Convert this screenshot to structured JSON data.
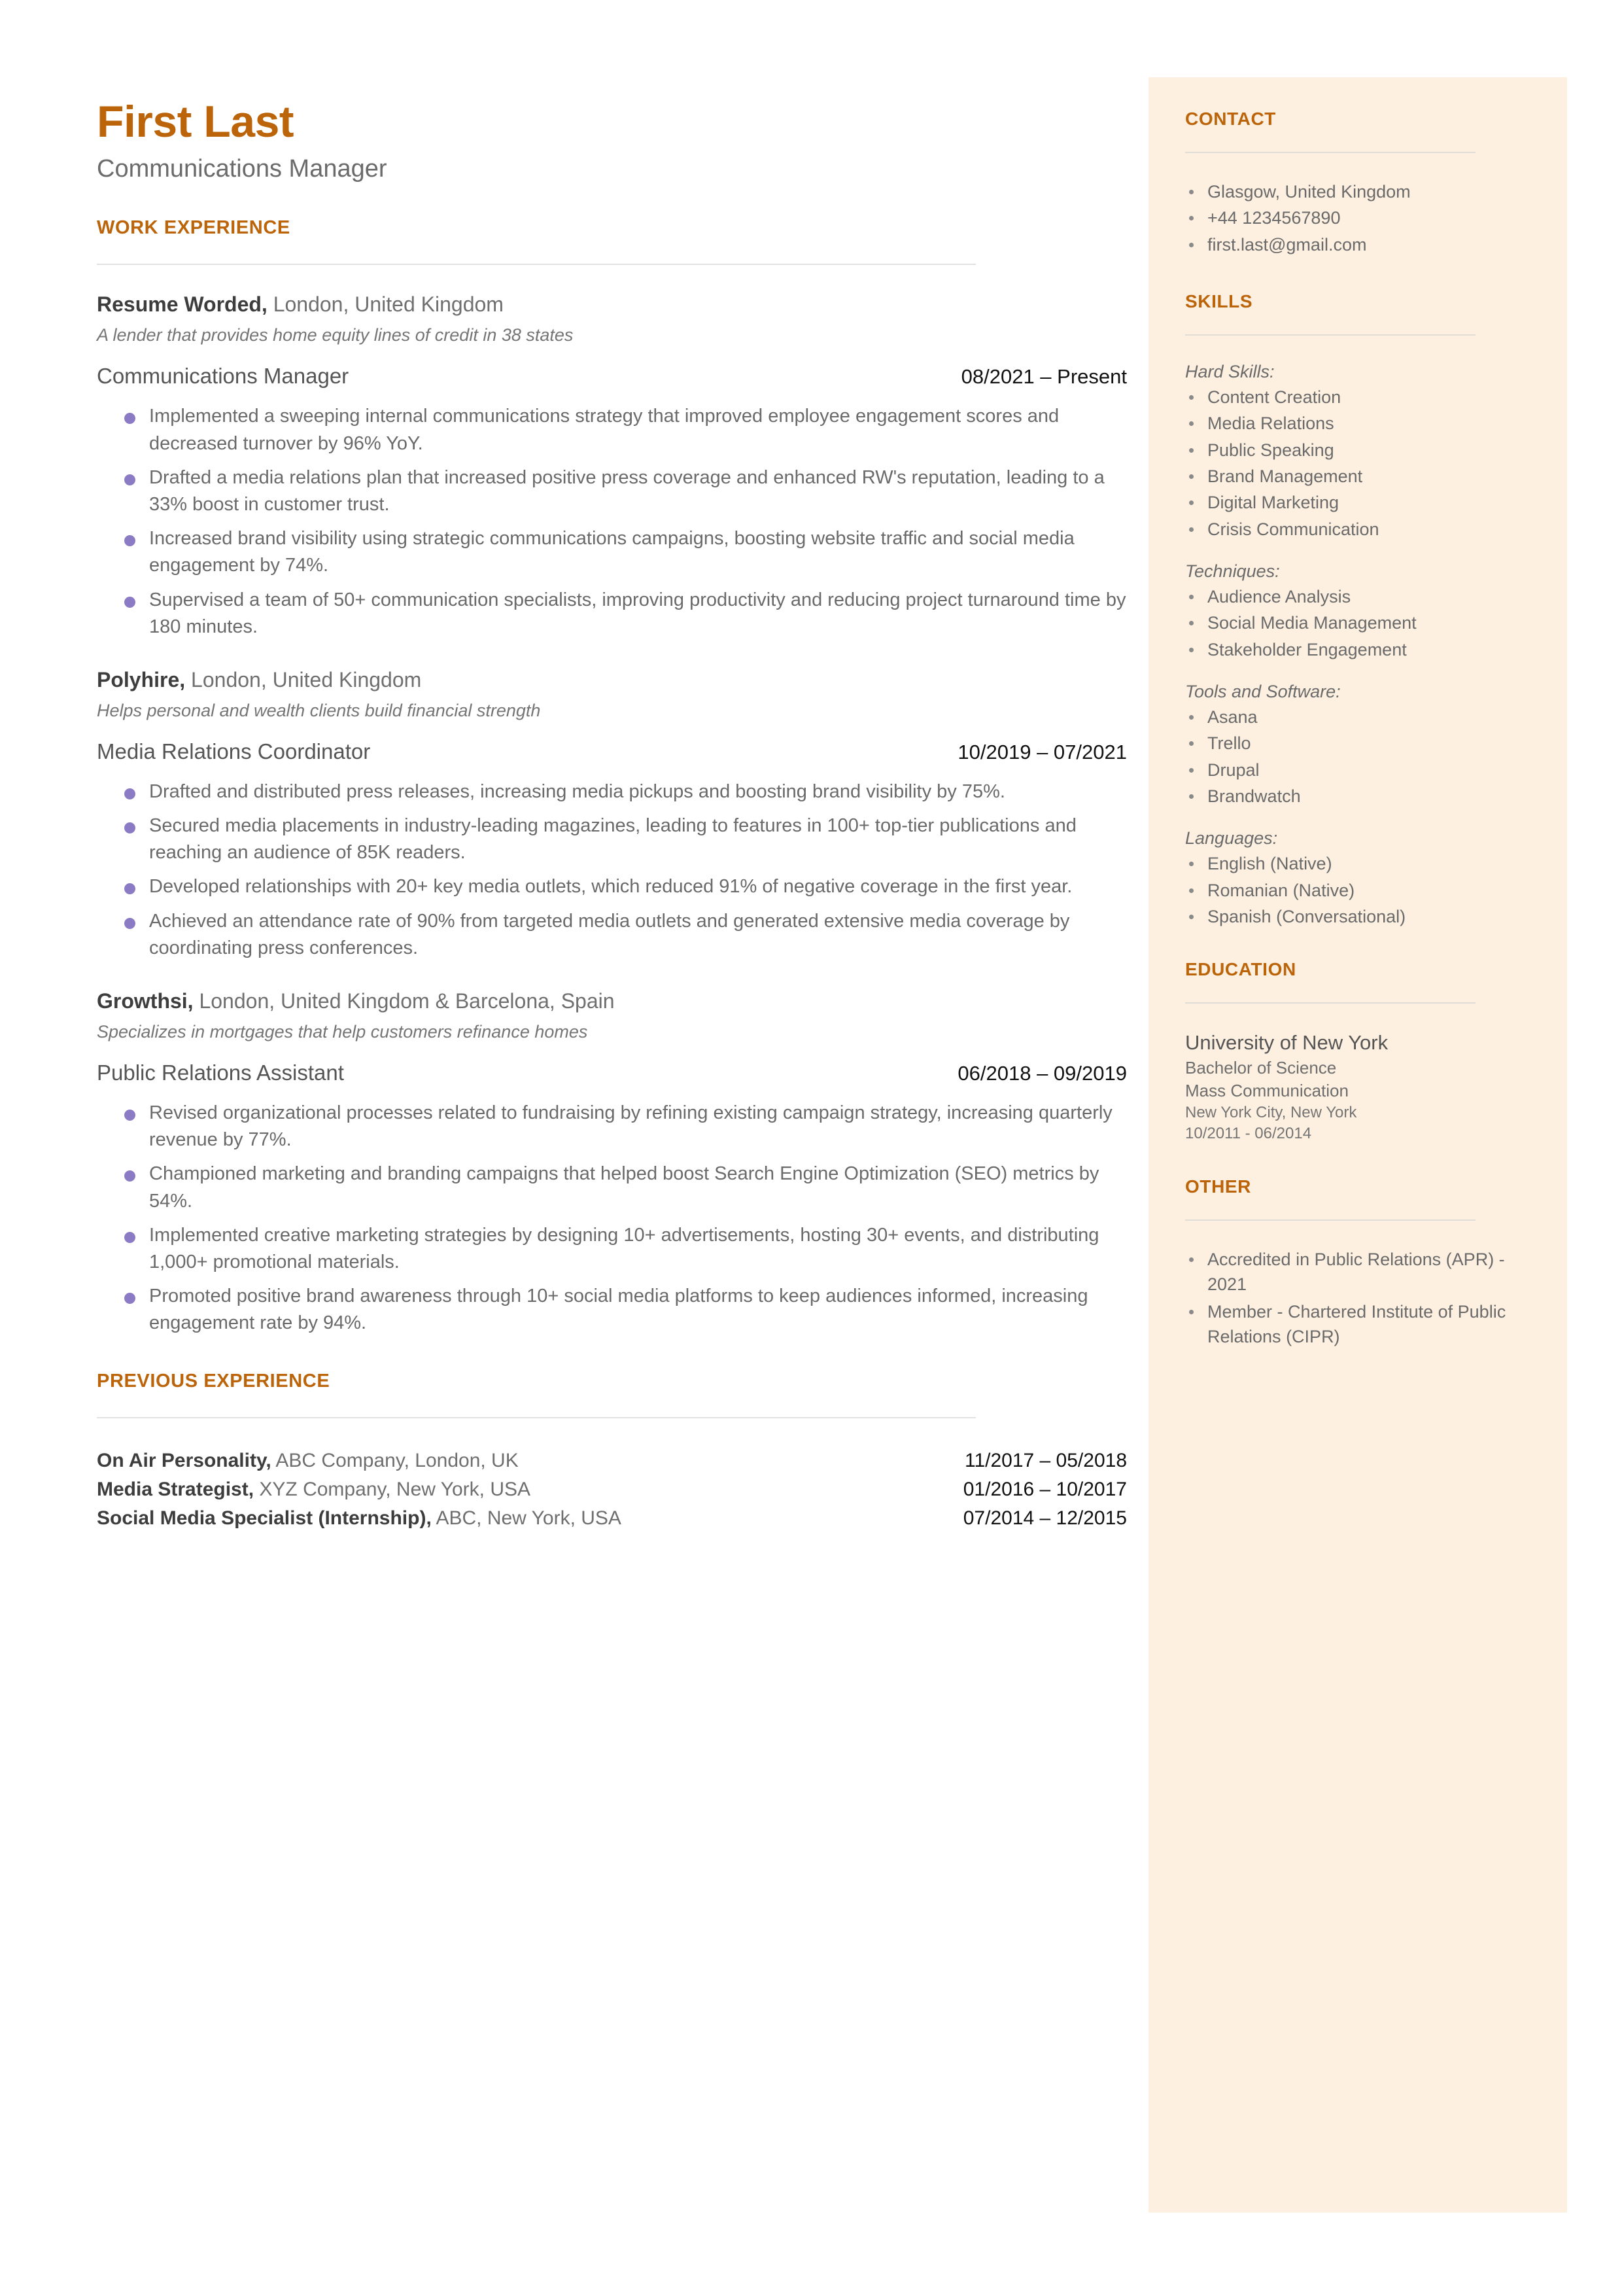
{
  "header": {
    "name": "First Last",
    "title": "Communications Manager"
  },
  "sections": {
    "work_experience": "WORK EXPERIENCE",
    "previous_experience": "PREVIOUS EXPERIENCE",
    "contact": "CONTACT",
    "skills": "SKILLS",
    "education": "EDUCATION",
    "other": "OTHER"
  },
  "colors": {
    "accent": "#bc640a",
    "sidebar_bg": "#fdf0e0",
    "bullet": "#8b7bc4",
    "rule": "#e2e2e2",
    "body_text": "#6a6a6a",
    "date_text": "#111111"
  },
  "experience": [
    {
      "company": "Resume Worded,",
      "location": " London, United Kingdom",
      "description": "A lender that provides home equity lines of credit in 38 states",
      "role": "Communications Manager",
      "dates": "08/2021 – Present",
      "bullets": [
        "Implemented a sweeping internal communications strategy that improved employee engagement scores and decreased turnover by 96% YoY.",
        "Drafted a media relations plan that increased positive press coverage and enhanced RW's reputation, leading to a 33% boost in customer trust.",
        "Increased brand visibility using strategic communications campaigns, boosting website traffic and social media engagement by 74%.",
        "Supervised a team of 50+ communication specialists, improving productivity and reducing project turnaround time by 180 minutes."
      ]
    },
    {
      "company": "Polyhire,",
      "location": " London, United Kingdom",
      "description": "Helps personal and wealth clients build financial strength",
      "role": "Media Relations Coordinator",
      "dates": "10/2019 – 07/2021",
      "bullets": [
        "Drafted and distributed press releases, increasing media pickups and boosting brand visibility by 75%.",
        "Secured media placements in industry-leading magazines, leading to features in 100+ top-tier publications and reaching an audience of 85K readers.",
        "Developed relationships with 20+ key media outlets, which reduced 91% of negative coverage in the first year.",
        "Achieved an attendance rate of 90% from targeted media outlets and generated extensive media coverage by coordinating press conferences."
      ]
    },
    {
      "company": "Growthsi,",
      "location": " London, United Kingdom & Barcelona, Spain",
      "description": "Specializes in mortgages that help customers refinance homes",
      "role": "Public Relations Assistant",
      "dates": "06/2018 – 09/2019",
      "bullets": [
        "Revised organizational processes related to fundraising by refining existing campaign strategy, increasing quarterly revenue by 77%.",
        "Championed marketing and branding campaigns that helped boost Search Engine Optimization (SEO) metrics by 54%.",
        "Implemented creative marketing strategies by designing 10+ advertisements, hosting 30+ events, and distributing 1,000+ promotional materials.",
        "Promoted positive brand awareness through 10+ social media platforms to keep audiences informed, increasing engagement rate by 94%."
      ]
    }
  ],
  "previous_experience": [
    {
      "role": "On Air Personality,",
      "detail": " ABC Company, London, UK",
      "dates": "11/2017 – 05/2018"
    },
    {
      "role": "Media Strategist,",
      "detail": " XYZ Company, New York, USA",
      "dates": "01/2016 – 10/2017"
    },
    {
      "role": "Social Media Specialist (Internship),",
      "detail": " ABC, New York, USA",
      "dates": "07/2014 – 12/2015"
    }
  ],
  "contact": [
    "Glasgow, United Kingdom",
    "+44 1234567890",
    "first.last@gmail.com"
  ],
  "skills": [
    {
      "label": "Hard Skills:",
      "items": [
        "Content Creation",
        "Media Relations",
        "Public Speaking",
        "Brand Management",
        "Digital Marketing",
        "Crisis Communication"
      ]
    },
    {
      "label": "Techniques:",
      "items": [
        "Audience Analysis",
        "Social Media Management",
        "Stakeholder Engagement"
      ]
    },
    {
      "label": "Tools and Software:",
      "items": [
        "Asana",
        "Trello",
        "Drupal",
        "Brandwatch"
      ]
    },
    {
      "label": "Languages:",
      "items": [
        "English (Native)",
        "Romanian (Native)",
        "Spanish (Conversational)"
      ]
    }
  ],
  "education": {
    "school": "University of New York",
    "degree": "Bachelor of Science",
    "field": "Mass Communication",
    "location": "New York City, New York",
    "dates": "10/2011 - 06/2014"
  },
  "other": [
    "Accredited in Public Relations (APR) - 2021",
    "Member -  Chartered Institute of Public Relations (CIPR)"
  ]
}
